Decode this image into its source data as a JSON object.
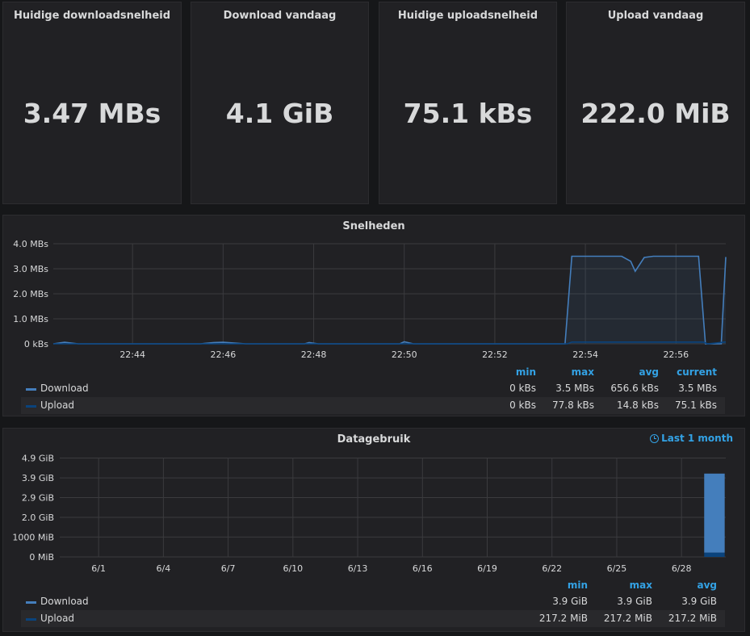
{
  "stats": [
    {
      "title": "Huidige downloadsnelheid",
      "value": "3.47 MBs"
    },
    {
      "title": "Download vandaag",
      "value": "4.1 GiB"
    },
    {
      "title": "Huidige uploadsnelheid",
      "value": "75.1 kBs"
    },
    {
      "title": "Upload vandaag",
      "value": "222.0 MiB"
    }
  ],
  "speeds": {
    "title": "Snelheden",
    "legend": {
      "headers": {
        "min": "min",
        "max": "max",
        "avg": "avg",
        "current": "current"
      },
      "rows": [
        {
          "name": "Download",
          "min": "0 kBs",
          "max": "3.5 MBs",
          "avg": "656.6 kBs",
          "current": "3.5 MBs"
        },
        {
          "name": "Upload",
          "min": "0 kBs",
          "max": "77.8 kBs",
          "avg": "14.8 kBs",
          "current": "75.1 kBs"
        }
      ]
    }
  },
  "usage": {
    "title": "Datagebruik",
    "range_label": "Last 1 month",
    "legend": {
      "headers": {
        "min": "min",
        "max": "max",
        "avg": "avg"
      },
      "rows": [
        {
          "name": "Download",
          "min": "3.9 GiB",
          "max": "3.9 GiB",
          "avg": "3.9 GiB"
        },
        {
          "name": "Upload",
          "min": "217.2 MiB",
          "max": "217.2 MiB",
          "avg": "217.2 MiB"
        }
      ]
    }
  },
  "colors": {
    "download": "#447ebc",
    "upload": "#0a437c",
    "accent": "#33a2e5"
  },
  "chart_data": [
    {
      "type": "area",
      "title": "Snelheden",
      "unit": "MBs",
      "ylim": [
        0,
        4
      ],
      "y_tick_labels": [
        "0 kBs",
        "1.0 MBs",
        "2.0 MBs",
        "3.0 MBs",
        "4.0 MBs"
      ],
      "x_tick_labels": [
        "22:44",
        "22:46",
        "22:48",
        "22:50",
        "22:52",
        "22:54",
        "22:56"
      ],
      "x_ticks": [
        44,
        46,
        48,
        50,
        52,
        54,
        56
      ],
      "xlim": [
        42.25,
        57.1
      ],
      "grid": true,
      "series": [
        {
          "name": "Download",
          "x": [
            42.25,
            42.5,
            42.8,
            43.5,
            45.5,
            45.8,
            46.0,
            46.5,
            47.8,
            47.9,
            48.1,
            49.9,
            50.0,
            50.2,
            51.0,
            53.0,
            53.55,
            53.7,
            54.8,
            55.0,
            55.1,
            55.3,
            55.5,
            56.0,
            56.5,
            56.65,
            56.8,
            57.0,
            57.1
          ],
          "y": [
            0.0,
            0.06,
            0.0,
            0.0,
            0.0,
            0.05,
            0.06,
            0.0,
            0.0,
            0.05,
            0.0,
            0.0,
            0.08,
            0.0,
            0.0,
            0.0,
            0.0,
            3.5,
            3.5,
            3.3,
            2.9,
            3.45,
            3.5,
            3.5,
            3.5,
            0.0,
            0.0,
            0.0,
            3.47
          ]
        },
        {
          "name": "Upload",
          "x": [
            42.25,
            53.6,
            53.7,
            56.6,
            56.7,
            57.1
          ],
          "y": [
            0.0,
            0.0,
            0.07,
            0.07,
            0.0,
            0.075
          ]
        }
      ]
    },
    {
      "type": "bar",
      "title": "Datagebruik",
      "unit": "GiB",
      "ylim": [
        0,
        4.9
      ],
      "y_tick_labels": [
        "0 MiB",
        "1000 MiB",
        "2.0 GiB",
        "2.9 GiB",
        "3.9 GiB",
        "4.9 GiB"
      ],
      "y_ticks": [
        0,
        0.98,
        1.95,
        2.93,
        3.9,
        4.88
      ],
      "x_tick_labels": [
        "6/1",
        "6/4",
        "6/7",
        "6/10",
        "6/13",
        "6/16",
        "6/19",
        "6/22",
        "6/25",
        "6/28"
      ],
      "x_ticks": [
        1,
        4,
        7,
        10,
        13,
        16,
        19,
        22,
        25,
        28
      ],
      "xlim": [
        -0.8,
        30.05
      ],
      "grid": true,
      "stacked": true,
      "categories": [
        "6/30"
      ],
      "series": [
        {
          "name": "Download",
          "values": [
            3.9
          ]
        },
        {
          "name": "Upload",
          "values": [
            0.212
          ]
        }
      ]
    }
  ]
}
